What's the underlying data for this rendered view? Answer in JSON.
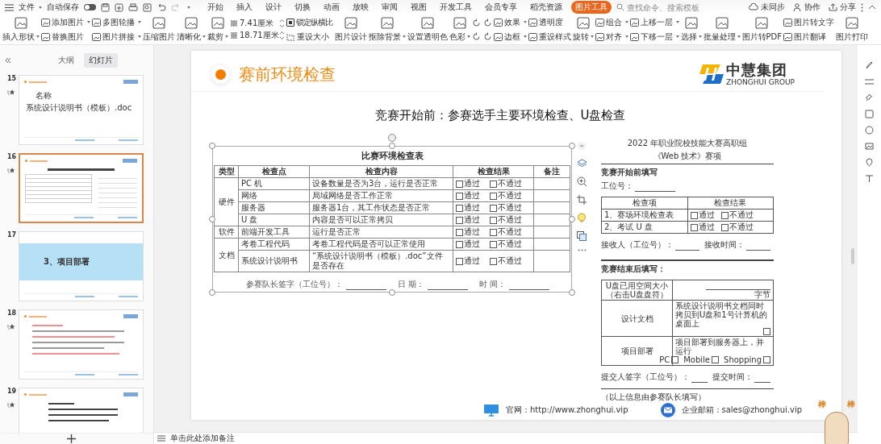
{
  "top_bar": {
    "file_menu": "文件",
    "autosave": {
      "label": "自动保存",
      "on": false
    },
    "tabs": [
      {
        "label": "开始",
        "selected": false
      },
      {
        "label": "插入",
        "selected": false
      },
      {
        "label": "设计",
        "selected": false
      },
      {
        "label": "切换",
        "selected": false
      },
      {
        "label": "动画",
        "selected": false
      },
      {
        "label": "放映",
        "selected": false
      },
      {
        "label": "审阅",
        "selected": false
      },
      {
        "label": "视图",
        "selected": false
      },
      {
        "label": "开发工具",
        "selected": false
      },
      {
        "label": "会员专享",
        "selected": false
      },
      {
        "label": "稻壳资源",
        "selected": false
      },
      {
        "label": "图片工具",
        "selected": true
      }
    ],
    "search": {
      "placeholder": "查找命令、搜索模板"
    },
    "actions": [
      {
        "label": "未同步",
        "kind": "cloud"
      },
      {
        "label": "协作",
        "kind": "person"
      },
      {
        "label": "分享",
        "kind": "share"
      }
    ]
  },
  "ribbon": [
    {
      "kind": "big",
      "label": "插入形状",
      "dropdown": true
    },
    {
      "kind": "pair",
      "items": [
        {
          "label": "添加图片",
          "dropdown": true
        },
        {
          "label": "替换图片",
          "dropdown": false
        }
      ]
    },
    {
      "kind": "pair",
      "items": [
        {
          "label": "多图轮播",
          "dropdown": true
        },
        {
          "label": "图片拼接",
          "dropdown": true
        }
      ]
    },
    {
      "kind": "big",
      "label": "压缩图片",
      "dropdown": false
    },
    {
      "kind": "big",
      "label": "清晰化",
      "dropdown": true
    },
    {
      "kind": "big",
      "label": "裁剪",
      "dropdown": true
    },
    {
      "kind": "size",
      "fields": [
        {
          "value": "7.41厘米"
        },
        {
          "value": "18.71厘米"
        }
      ]
    },
    {
      "kind": "check",
      "check": {
        "label": "锁定纵横比",
        "checked": true
      },
      "button": "重设大小"
    },
    {
      "kind": "big",
      "label": "图片设计",
      "dropdown": false
    },
    {
      "kind": "big",
      "label": "抠除背景",
      "dropdown": true
    },
    {
      "kind": "big",
      "label": "设置透明色",
      "dropdown": false
    },
    {
      "kind": "big",
      "label": "色彩",
      "dropdown": true
    },
    {
      "kind": "icons"
    },
    {
      "kind": "pair",
      "items": [
        {
          "label": "效果",
          "dropdown": true
        },
        {
          "label": "边框",
          "dropdown": true
        }
      ]
    },
    {
      "kind": "pair",
      "items": [
        {
          "label": "透明度",
          "dropdown": false
        },
        {
          "label": "重设样式",
          "dropdown": false
        }
      ]
    },
    {
      "kind": "big",
      "label": "旋转",
      "dropdown": true
    },
    {
      "kind": "pair",
      "items": [
        {
          "label": "组合",
          "dropdown": true
        },
        {
          "label": "对齐",
          "dropdown": true
        }
      ]
    },
    {
      "kind": "pair",
      "items": [
        {
          "label": "上移一层",
          "dropdown": true
        },
        {
          "label": "下移一层",
          "dropdown": true
        }
      ]
    },
    {
      "kind": "big",
      "label": "选择",
      "dropdown": true
    },
    {
      "kind": "big",
      "label": "批量处理",
      "dropdown": true
    },
    {
      "kind": "big",
      "label": "图片转PDF",
      "dropdown": false
    },
    {
      "kind": "pair",
      "items": [
        {
          "label": "图片转文字",
          "dropdown": false
        },
        {
          "label": "图片翻译",
          "dropdown": false
        }
      ]
    },
    {
      "kind": "big",
      "label": "图片打印",
      "dropdown": false
    }
  ],
  "slide_panel": {
    "tabs": [
      {
        "label": "大纲",
        "selected": false
      },
      {
        "label": "幻灯片",
        "selected": true
      }
    ],
    "slides": [
      {
        "number": "15",
        "animated": true,
        "selected": false,
        "kind": "file",
        "texts": [
          "名称",
          "系统设计说明书（模板）.doc"
        ]
      },
      {
        "number": "16",
        "animated": true,
        "selected": true,
        "kind": "table"
      },
      {
        "number": "17",
        "animated": false,
        "selected": false,
        "kind": "section",
        "texts": [
          "3、项目部署"
        ]
      },
      {
        "number": "18",
        "animated": true,
        "selected": false,
        "kind": "list"
      },
      {
        "number": "19",
        "animated": true,
        "selected": false,
        "kind": "text"
      }
    ]
  },
  "slide": {
    "title": "赛前环境检查",
    "logo": {
      "name": "中慧集团",
      "subtitle": "ZHONGHUI GROUP"
    },
    "heading": "竞赛开始前：参赛选手主要环境检查、U盘检查",
    "check_table": {
      "title": "比赛环境检查表",
      "columns": [
        "类型",
        "检查点",
        "检查内容",
        "检查结果",
        "备注"
      ],
      "groups": [
        {
          "type": "硬件",
          "rows": [
            {
              "point": "PC 机",
              "content": "设备数量是否为3台，运行是否正常",
              "results": [
                {
                  "label": "通过",
                  "checked": false
                },
                {
                  "label": "不通过",
                  "checked": false
                }
              ]
            },
            {
              "point": "网络",
              "content": "局域网络是否工作正常",
              "results": [
                {
                  "label": "通过",
                  "checked": false
                },
                {
                  "label": "不通过",
                  "checked": false
                }
              ]
            },
            {
              "point": "服务器",
              "content": "服务器1台，其工作状态是否正常",
              "results": [
                {
                  "label": "通过",
                  "checked": false
                },
                {
                  "label": "不通过",
                  "checked": false
                }
              ]
            },
            {
              "point": "U 盘",
              "content": "内容是否可以正常拷贝",
              "results": [
                {
                  "label": "通过",
                  "checked": false
                },
                {
                  "label": "不通过",
                  "checked": false
                }
              ]
            }
          ]
        },
        {
          "type": "软件",
          "rows": [
            {
              "point": "前端开发工具",
              "content": "运行是否正常",
              "results": [
                {
                  "label": "通过",
                  "checked": false
                },
                {
                  "label": "不通过",
                  "checked": false
                }
              ]
            }
          ]
        },
        {
          "type": "文档",
          "rows": [
            {
              "point": "考卷工程代码",
              "content": "考卷工程代码是否可以正常使用",
              "results": [
                {
                  "label": "通过",
                  "checked": false
                },
                {
                  "label": "不通过",
                  "checked": false
                }
              ]
            },
            {
              "point": "系统设计说明书",
              "content": "“系统设计说明书（模板）.doc”文件是否存在",
              "results": [
                {
                  "label": "通过",
                  "checked": false
                },
                {
                  "label": "不通过",
                  "checked": false
                }
              ]
            }
          ]
        }
      ],
      "signature": [
        "参赛队长签字（工位号）：",
        "日 期：",
        "时 间："
      ]
    },
    "doc": {
      "title": [
        "2022 年职业院校技能大赛高职组",
        "《Web 技术》赛项"
      ],
      "section_1": "竞赛开始前填写",
      "station": "工位号：",
      "table_1": {
        "columns": [
          "检查项",
          "检查结果"
        ],
        "rows": [
          {
            "item": "1、赛场环境检查表",
            "results": [
              {
                "label": "通过",
                "checked": false
              },
              {
                "label": "不通过",
                "checked": false
              }
            ]
          },
          {
            "item": "2、考试 U 盘",
            "results": [
              {
                "label": "通过",
                "checked": false
              },
              {
                "label": "不通过",
                "checked": false
              }
            ]
          }
        ]
      },
      "receiver": [
        "接收人（工位号）：",
        "接收时间："
      ],
      "section_2": "竞赛结束后填写：",
      "table_2": [
        {
          "item": "U盘已用空间大小（右击U盘盘符）",
          "kind": "blank",
          "value": "字节"
        },
        {
          "item": "设计文档",
          "kind": "checks",
          "text": "系统设计说明书文档同时拷贝到U盘和1号计算机的桌面上",
          "checks": [
            {
              "checked": false
            }
          ]
        },
        {
          "item": "项目部署",
          "kind": "checks",
          "text": "项目部署到服务器上，并运行",
          "checks": [
            {
              "label": "PC",
              "checked": false
            },
            {
              "label": "Mobile",
              "checked": false
            },
            {
              "label": "Shopping",
              "checked": false
            }
          ]
        }
      ],
      "submit": [
        "提交人签字（工位号）：",
        "提交时间："
      ],
      "note": "（以上信息由参赛队长填写）"
    },
    "footer": [
      {
        "kind": "web",
        "text": "官网：http://www.zhonghui.vip"
      },
      {
        "kind": "mail",
        "text": "企业邮箱：sales@zhonghui.vip"
      }
    ]
  },
  "notes": {
    "placeholder": "单击此处添加备注"
  },
  "sticker": {
    "text": [
      "棒",
      "棒"
    ]
  }
}
